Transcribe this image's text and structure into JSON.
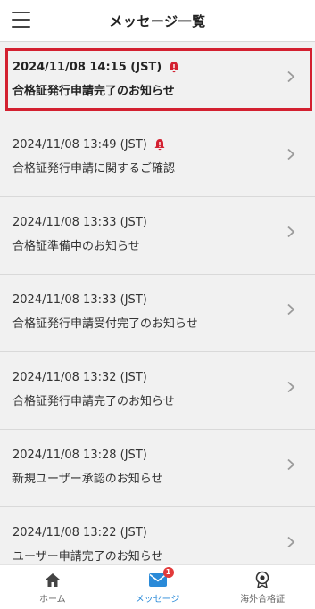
{
  "header": {
    "title": "メッセージ一覧",
    "menu_icon": "hamburger-menu-icon"
  },
  "colors": {
    "highlight_border": "#d32030",
    "bell": "#d32030",
    "active_tab": "#2a8ad8",
    "badge": "#e23a3a"
  },
  "messages": [
    {
      "timestamp": "2024/11/08 14:15 (JST)",
      "subject": "合格証発行申請完了のお知らせ",
      "unread": true
    },
    {
      "timestamp": "2024/11/08 13:49 (JST)",
      "subject": "合格証発行申請に関するご確認",
      "unread": true
    },
    {
      "timestamp": "2024/11/08 13:33 (JST)",
      "subject": "合格証準備中のお知らせ",
      "unread": false
    },
    {
      "timestamp": "2024/11/08 13:33 (JST)",
      "subject": "合格証発行申請受付完了のお知らせ",
      "unread": false
    },
    {
      "timestamp": "2024/11/08 13:32 (JST)",
      "subject": "合格証発行申請完了のお知らせ",
      "unread": false
    },
    {
      "timestamp": "2024/11/08 13:28 (JST)",
      "subject": "新規ユーザー承認のお知らせ",
      "unread": false
    },
    {
      "timestamp": "2024/11/08 13:22 (JST)",
      "subject": "ユーザー申請完了のお知らせ",
      "unread": false
    }
  ],
  "bottom_nav": {
    "home_label": "ホーム",
    "messages_label": "メッセージ",
    "messages_badge": "1",
    "certificate_label": "海外合格証"
  }
}
